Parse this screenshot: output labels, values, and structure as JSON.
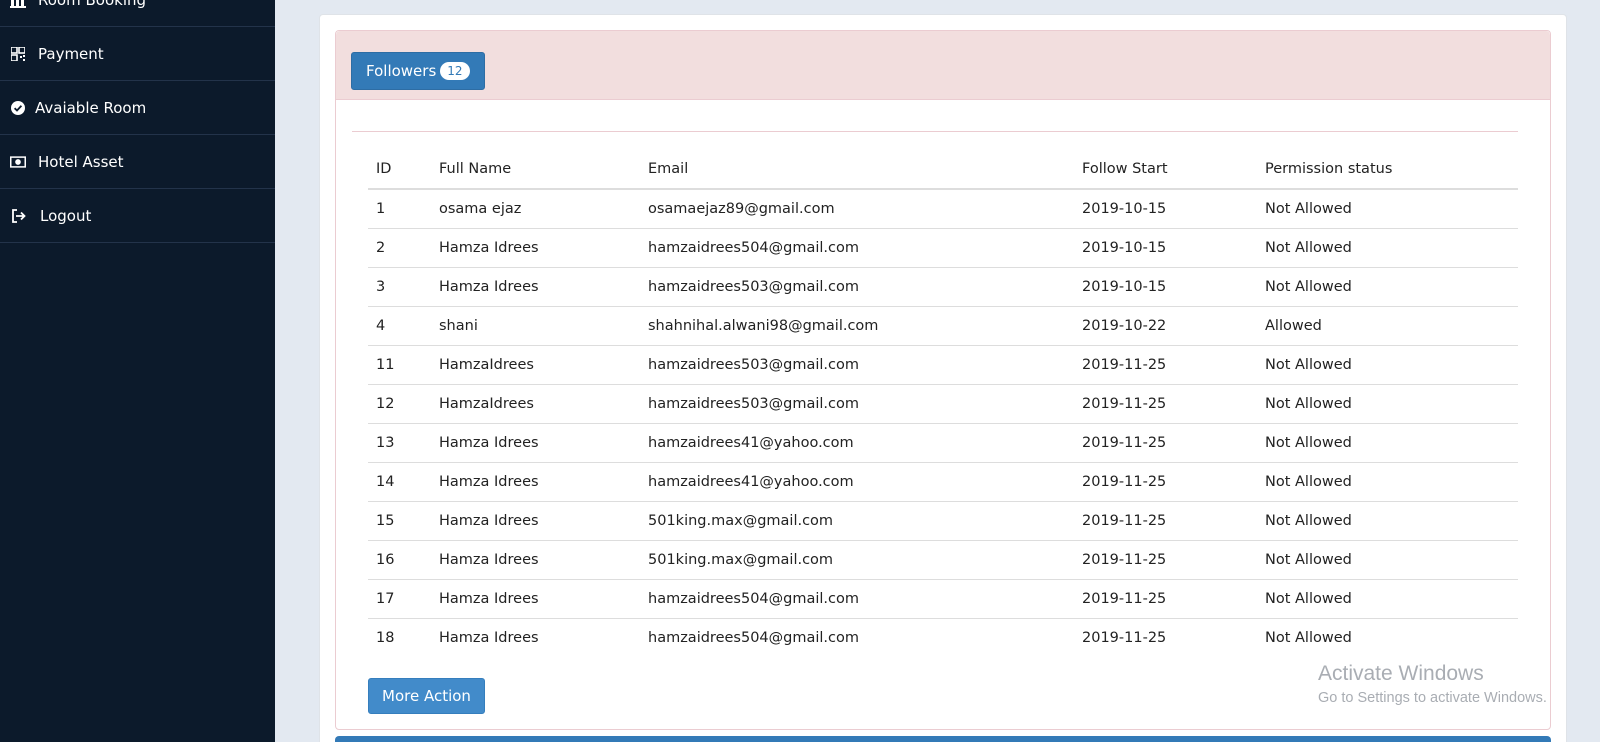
{
  "sidebar": {
    "items": [
      {
        "label": "Room Booking",
        "icon": "bar-chart-icon"
      },
      {
        "label": "Payment",
        "icon": "qr-code-icon"
      },
      {
        "label": "Avaiable Room",
        "icon": "check-circle-icon"
      },
      {
        "label": "Hotel Asset",
        "icon": "money-icon"
      },
      {
        "label": "Logout",
        "icon": "logout-icon"
      }
    ]
  },
  "panel": {
    "followers_label": "Followers",
    "followers_count": "12"
  },
  "table": {
    "headers": [
      "ID",
      "Full Name",
      "Email",
      "Follow Start",
      "Permission status"
    ],
    "rows": [
      [
        "1",
        "osama ejaz",
        "osamaejaz89@gmail.com",
        "2019-10-15",
        "Not Allowed"
      ],
      [
        "2",
        "Hamza Idrees",
        "hamzaidrees504@gmail.com",
        "2019-10-15",
        "Not Allowed"
      ],
      [
        "3",
        "Hamza Idrees",
        "hamzaidrees503@gmail.com",
        "2019-10-15",
        "Not Allowed"
      ],
      [
        "4",
        "shani",
        "shahnihal.alwani98@gmail.com",
        "2019-10-22",
        "Allowed"
      ],
      [
        "11",
        "HamzaIdrees",
        "hamzaidrees503@gmail.com",
        "2019-11-25",
        "Not Allowed"
      ],
      [
        "12",
        "HamzaIdrees",
        "hamzaidrees503@gmail.com",
        "2019-11-25",
        "Not Allowed"
      ],
      [
        "13",
        "Hamza Idrees",
        "hamzaidrees41@yahoo.com",
        "2019-11-25",
        "Not Allowed"
      ],
      [
        "14",
        "Hamza Idrees",
        "hamzaidrees41@yahoo.com",
        "2019-11-25",
        "Not Allowed"
      ],
      [
        "15",
        "Hamza Idrees",
        "501king.max@gmail.com",
        "2019-11-25",
        "Not Allowed"
      ],
      [
        "16",
        "Hamza Idrees",
        "501king.max@gmail.com",
        "2019-11-25",
        "Not Allowed"
      ],
      [
        "17",
        "Hamza Idrees",
        "hamzaidrees504@gmail.com",
        "2019-11-25",
        "Not Allowed"
      ],
      [
        "18",
        "Hamza Idrees",
        "hamzaidrees504@gmail.com",
        "2019-11-25",
        "Not Allowed"
      ]
    ]
  },
  "more_action_label": "More Action",
  "watermark": {
    "line1": "Activate Windows",
    "line2": "Go to Settings to activate Windows."
  },
  "colors": {
    "sidebar_bg": "#0c1a2b",
    "primary": "#337ab7",
    "panel_head_bg": "#f2dede"
  }
}
